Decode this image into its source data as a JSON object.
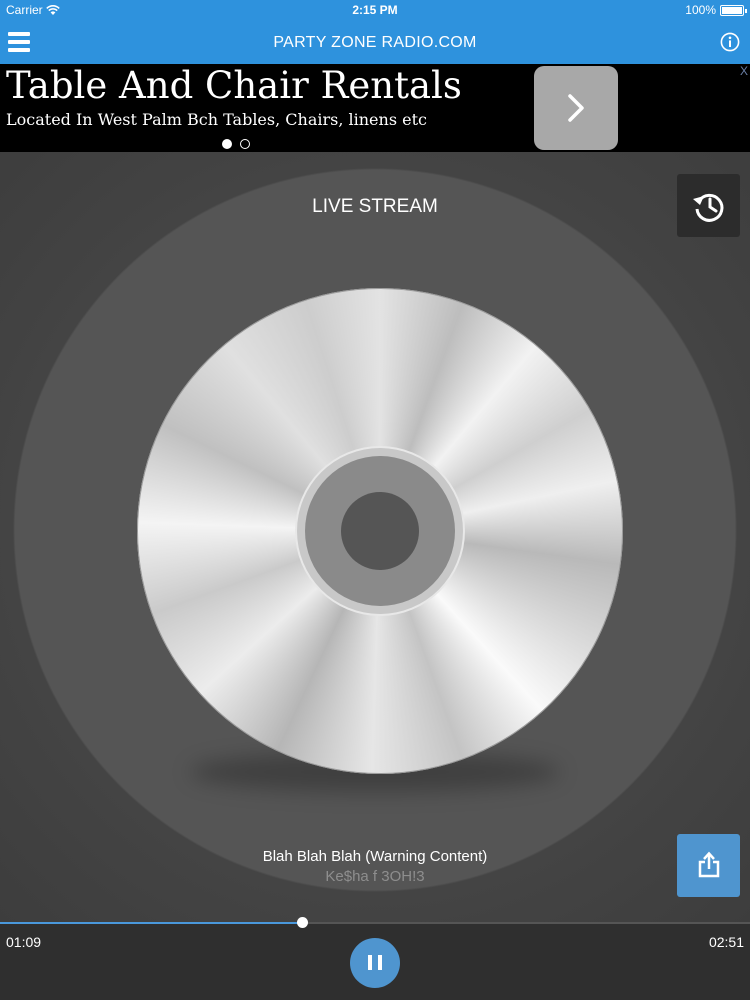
{
  "status_bar": {
    "carrier": "Carrier",
    "time": "2:15 PM",
    "battery": "100%"
  },
  "nav": {
    "title": "PARTY ZONE RADIO.COM"
  },
  "ad": {
    "headline": "Table And Chair Rentals",
    "subline": "Located In West Palm Bch Tables, Chairs, linens etc",
    "close": "X",
    "page_count": 2,
    "active_page": 1
  },
  "player": {
    "label": "LIVE STREAM",
    "track_title": "Blah Blah Blah (Warning Content)",
    "track_artist": "Ke$ha f 3OH!3"
  },
  "transport": {
    "elapsed": "01:09",
    "duration": "02:51",
    "progress": 0.403
  },
  "colors": {
    "accent": "#2e92dd",
    "button": "#4f95cf"
  }
}
